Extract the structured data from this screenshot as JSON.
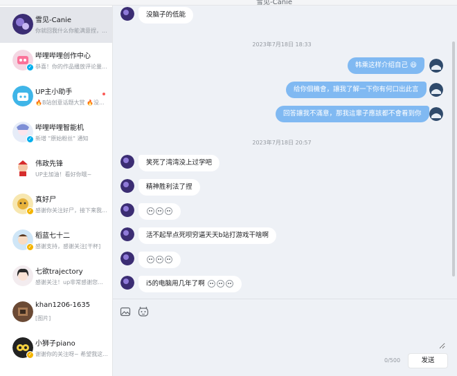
{
  "window": {
    "left_title": "",
    "title": "雪见-Canie"
  },
  "colors": {
    "accent_outgoing_bubble": "#80b9f2",
    "incoming_bubble": "#ffffff",
    "unread_dot": "#fa5a57",
    "chat_background": "#eef1f6"
  },
  "sidebar": {
    "conversations": [
      {
        "name": "雪见-Canie",
        "preview": "你就回我什么你能满意捏，...",
        "avatar_icon": "purple-avatar-icon"
      },
      {
        "name": "哔哩哔哩创作中心",
        "preview": "恭喜！你的作品播放评论量...",
        "avatar_icon": "bilibili-creator-avatar-icon"
      },
      {
        "name": "UP主小助手",
        "preview": "🔥B站创意话题大赏 🔥没...",
        "avatar_icon": "tv-mascot-avatar-icon",
        "unread": true
      },
      {
        "name": "哔哩哔哩智能机",
        "preview": "新增 \"原始粉丝\" 通知",
        "avatar_icon": "mascot-girl-avatar-icon"
      },
      {
        "name": "伟政先锋",
        "preview": "UP主加油！看好你哦~",
        "avatar_icon": "cartoon-kid-avatar-icon"
      },
      {
        "name": "真好尸",
        "preview": "感谢你关注好尸，接下来我...",
        "avatar_icon": "yellow-character-avatar-icon"
      },
      {
        "name": "稻蓝七十二",
        "preview": "感谢支持，感谢关注[干杯]",
        "avatar_icon": "anime-boy-avatar-icon"
      },
      {
        "name": "七欲trajectory",
        "preview": "感谢关注！up非常感谢您...",
        "avatar_icon": "anime-girl-avatar-icon"
      },
      {
        "name": "khan1206-1635",
        "preview": "[图片]",
        "avatar_icon": "photo-avatar-icon"
      },
      {
        "name": "小狮子piano",
        "preview": "谢谢你的关注呀~ 希望我这...",
        "avatar_icon": "lion-avatar-icon"
      }
    ]
  },
  "chat": {
    "messages": [
      {
        "side": "in",
        "text": "没脑子的低能"
      },
      {
        "type": "time",
        "text": "2023年7月18日 18:33"
      },
      {
        "side": "out",
        "text": "介绍自己",
        "prefix": "韩乘这样",
        "emoji": "😆"
      },
      {
        "side": "out",
        "text": "给你個機會，讓我了解一下你有何口出此言"
      },
      {
        "side": "out",
        "text": "回答讓我不滿意，那我這輩子應該都不會看到你"
      },
      {
        "type": "time",
        "text": "2023年7月18日 20:57"
      },
      {
        "side": "in",
        "text": "笑死了湾湾没上过学吧"
      },
      {
        "side": "in",
        "text": "精神胜利法了捏"
      },
      {
        "side": "in",
        "text": "",
        "emoji_count": 3
      },
      {
        "side": "in",
        "text": "活不起早点死呗穷逼天天b站打游戏干啥啊"
      },
      {
        "side": "in",
        "text": "",
        "emoji_count": 3
      },
      {
        "side": "in",
        "text": "i5的电脑用几年了啊",
        "emoji_count": 3
      }
    ]
  },
  "composer": {
    "placeholder": "",
    "counter": "0/500",
    "send_label": "发送",
    "tools": [
      "image-icon",
      "emoji-icon"
    ]
  }
}
